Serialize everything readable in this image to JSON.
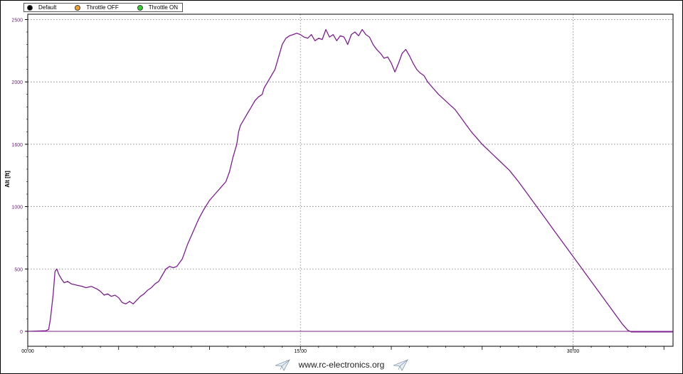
{
  "legend": {
    "items": [
      {
        "label": "Default",
        "color": "#000000"
      },
      {
        "label": "Throttle OFF",
        "color": "#f0a030"
      },
      {
        "label": "Throttle ON",
        "color": "#33cc33"
      }
    ]
  },
  "footer": {
    "text": "www.rc-electronics.org",
    "icon": "paper-plane-icon"
  },
  "colors": {
    "series": "#7b1f8c",
    "axis_text": "#7b1f8c",
    "grid": "#7a7a7a"
  },
  "chart_data": {
    "type": "line",
    "title": "",
    "xlabel": "",
    "ylabel": "Alt [ft]",
    "xlim": [
      0,
      35.5
    ],
    "ylim": [
      -120,
      2520
    ],
    "x_ticks": [
      0,
      15,
      30
    ],
    "x_tick_labels": [
      "00:00",
      "15:00",
      "30:00"
    ],
    "y_ticks": [
      0,
      500,
      1000,
      1500,
      2000,
      2500
    ],
    "y_tick_labels": [
      "0",
      "500",
      "1000",
      "1600",
      "2000",
      "2500"
    ],
    "grid": "dotted",
    "legend_position": "top-left",
    "series": [
      {
        "color": "#7b1f8c",
        "x": [
          0,
          1.0,
          1.15,
          1.25,
          1.4,
          1.5,
          1.6,
          1.7,
          1.85,
          2.0,
          2.2,
          2.4,
          2.7,
          3.0,
          3.2,
          3.5,
          3.8,
          4.0,
          4.2,
          4.4,
          4.6,
          4.8,
          5.0,
          5.2,
          5.4,
          5.6,
          5.8,
          6.0,
          6.2,
          6.4,
          6.6,
          6.8,
          7.0,
          7.2,
          7.4,
          7.6,
          7.8,
          8.0,
          8.2,
          8.5,
          8.8,
          9.1,
          9.4,
          9.7,
          10.0,
          10.3,
          10.6,
          10.9,
          11.1,
          11.3,
          11.5,
          11.6,
          11.7,
          11.9,
          12.1,
          12.3,
          12.5,
          12.7,
          12.9,
          13.0,
          13.2,
          13.4,
          13.6,
          13.8,
          14.0,
          14.2,
          14.4,
          14.6,
          14.8,
          15.0,
          15.2,
          15.4,
          15.6,
          15.8,
          16.0,
          16.2,
          16.4,
          16.6,
          16.8,
          17.0,
          17.2,
          17.4,
          17.6,
          17.8,
          18.0,
          18.2,
          18.4,
          18.6,
          18.8,
          19.0,
          19.2,
          19.4,
          19.6,
          19.8,
          20.0,
          20.2,
          20.4,
          20.6,
          20.8,
          21.0,
          21.2,
          21.4,
          21.6,
          21.8,
          22.0,
          22.3,
          22.6,
          22.9,
          23.2,
          23.5,
          23.8,
          24.1,
          24.4,
          24.7,
          25.0,
          25.5,
          26.0,
          26.5,
          27.0,
          27.5,
          28.0,
          28.5,
          29.0,
          29.5,
          30.0,
          30.5,
          31.0,
          31.5,
          32.0,
          32.4,
          32.7,
          33.0,
          33.2,
          33.5,
          34.0,
          34.5,
          35.0,
          35.5
        ],
        "y": [
          0,
          5,
          15,
          100,
          300,
          480,
          500,
          460,
          420,
          390,
          400,
          380,
          370,
          360,
          350,
          360,
          340,
          320,
          290,
          300,
          280,
          290,
          270,
          230,
          220,
          240,
          220,
          250,
          280,
          300,
          330,
          350,
          380,
          400,
          450,
          500,
          520,
          510,
          520,
          580,
          700,
          800,
          900,
          980,
          1050,
          1100,
          1150,
          1200,
          1280,
          1400,
          1500,
          1600,
          1650,
          1700,
          1750,
          1800,
          1850,
          1880,
          1900,
          1950,
          2000,
          2050,
          2100,
          2200,
          2300,
          2350,
          2370,
          2380,
          2390,
          2380,
          2360,
          2350,
          2380,
          2330,
          2350,
          2340,
          2420,
          2360,
          2380,
          2330,
          2370,
          2360,
          2300,
          2380,
          2400,
          2370,
          2420,
          2380,
          2360,
          2300,
          2260,
          2230,
          2190,
          2200,
          2150,
          2080,
          2150,
          2230,
          2260,
          2210,
          2150,
          2100,
          2070,
          2050,
          2000,
          1950,
          1900,
          1860,
          1820,
          1780,
          1720,
          1660,
          1600,
          1550,
          1500,
          1430,
          1360,
          1290,
          1200,
          1100,
          1000,
          900,
          800,
          700,
          600,
          500,
          400,
          300,
          200,
          120,
          60,
          10,
          -5,
          -5,
          -5,
          -5,
          -5,
          -5
        ]
      },
      {
        "color": "#7b1f8c",
        "x": [
          0,
          35.5
        ],
        "y": [
          0,
          0
        ]
      }
    ]
  }
}
